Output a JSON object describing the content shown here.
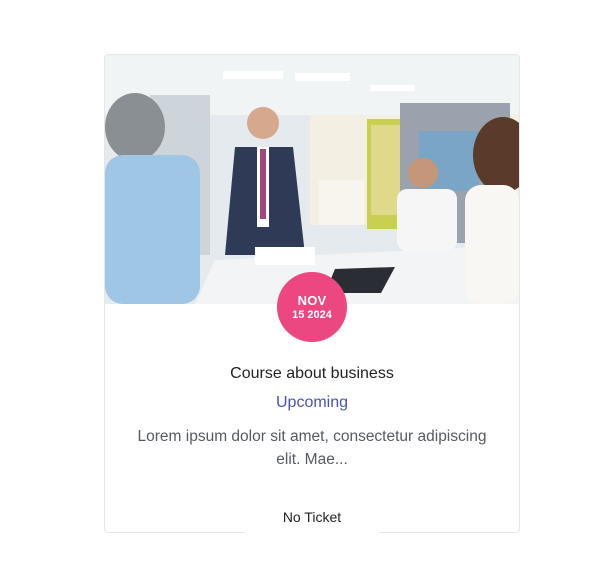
{
  "event": {
    "image_alt": "business-meeting-photo",
    "date": {
      "month": "NOV",
      "day_year": "15 2024"
    },
    "title": "Course about business",
    "status": "Upcoming",
    "description": "Lorem ipsum dolor sit amet, consectetur adipiscing elit. Mae...",
    "ticket_label": "No Ticket"
  },
  "colors": {
    "badge": "#ec4780",
    "status": "#4556a8",
    "title": "#222222",
    "description": "#555b61"
  }
}
